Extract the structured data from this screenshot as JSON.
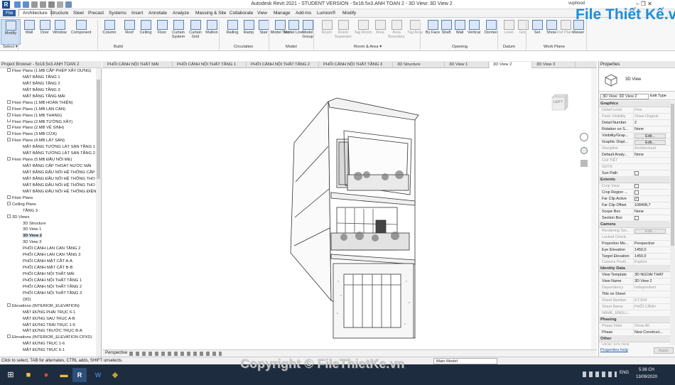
{
  "title_bar": {
    "title": "Autodesk Revit 2021 - STUDENT VERSION - 5x18.5x3.ANH TOAN 2 - 3D View: 3D View 2",
    "user": "vuphood",
    "window_controls": "–  ❐  ✕"
  },
  "menu": [
    "File",
    "Architecture",
    "Structure",
    "Steel",
    "Precast",
    "Systems",
    "Insert",
    "Annotate",
    "Analyze",
    "Massing & Site",
    "Collaborate",
    "View",
    "Manage",
    "Add-Ins",
    "Lumion®",
    "Modify"
  ],
  "ribbon": {
    "buttons": [
      {
        "label": "Modify",
        "disabled": false
      },
      {
        "label": "Wall",
        "disabled": false
      },
      {
        "label": "Door",
        "disabled": false
      },
      {
        "label": "Window",
        "disabled": false
      },
      {
        "label": "Component",
        "disabled": false
      },
      {
        "label": "Column",
        "disabled": false
      },
      {
        "label": "Roof",
        "disabled": false
      },
      {
        "label": "Ceiling",
        "disabled": false
      },
      {
        "label": "Floor",
        "disabled": false
      },
      {
        "label": "Curtain System",
        "disabled": false
      },
      {
        "label": "Curtain Grid",
        "disabled": false
      },
      {
        "label": "Mullion",
        "disabled": false
      },
      {
        "label": "Railing",
        "disabled": false
      },
      {
        "label": "Ramp",
        "disabled": false
      },
      {
        "label": "Stair",
        "disabled": false
      },
      {
        "label": "Model Text",
        "disabled": false
      },
      {
        "label": "Model Line",
        "disabled": false
      },
      {
        "label": "Model Group",
        "disabled": false
      },
      {
        "label": "Room",
        "disabled": true
      },
      {
        "label": "Room Separator",
        "disabled": true
      },
      {
        "label": "Tag Room",
        "disabled": true
      },
      {
        "label": "Area",
        "disabled": true
      },
      {
        "label": "Area Boundary",
        "disabled": true
      },
      {
        "label": "Tag Area",
        "disabled": true
      },
      {
        "label": "By Face",
        "disabled": false
      },
      {
        "label": "Shaft",
        "disabled": false
      },
      {
        "label": "Wall",
        "disabled": false
      },
      {
        "label": "Vertical",
        "disabled": false
      },
      {
        "label": "Dormer",
        "disabled": false
      },
      {
        "label": "Level",
        "disabled": true
      },
      {
        "label": "Grid",
        "disabled": true
      },
      {
        "label": "Set",
        "disabled": false
      },
      {
        "label": "Show",
        "disabled": false
      },
      {
        "label": "Ref Plane",
        "disabled": true
      },
      {
        "label": "Viewer",
        "disabled": false
      }
    ],
    "groups": [
      "Select ▾",
      "Build",
      "Circulation",
      "Model",
      "Room & Area ▾",
      "Opening",
      "Datum",
      "Work Plane"
    ]
  },
  "view_tabs": [
    "PHỐI CẢNH NỘI THẤT MÁI",
    "PHỐI CẢNH NỘI THẤT TẦNG 1",
    "PHỐI CẢNH NỘI THẤT TẦNG 2",
    "PHỐI CẢNH NỘI THẤT TẦNG 3",
    "3D Structure",
    "3D View 1",
    "3D View 2",
    "3D View 3"
  ],
  "active_view_tab": "3D View 2",
  "project_browser": {
    "title": "Project Browser - 5x18.5x3.ANH TOAN 2",
    "items": [
      {
        "text": "Floor Plans (1.MB CẤP PHÉP XÂY DỰNG)",
        "level": 1,
        "toggle": true
      },
      {
        "text": "MẶT BẰNG TẦNG 1",
        "level": 2
      },
      {
        "text": "MẶT BẰNG TẦNG 2",
        "level": 2
      },
      {
        "text": "MẶT BẰNG TẦNG 3",
        "level": 2
      },
      {
        "text": "MẶT BẰNG TẦNG MÁI",
        "level": 2
      },
      {
        "text": "Floor Plans (1.MB HOÀN THIỆN)",
        "level": 1,
        "toggle": true
      },
      {
        "text": "Floor Plans (1.MB LAN CAN)",
        "level": 1,
        "toggle": true
      },
      {
        "text": "Floor Plans (1.MB THANG)",
        "level": 1,
        "toggle": true
      },
      {
        "text": "Floor Plans (2.MB TƯỜNG XÂY)",
        "level": 1,
        "toggle": true
      },
      {
        "text": "Floor Plans (2.MB VỆ SINH)",
        "level": 1,
        "toggle": true
      },
      {
        "text": "Floor Plans (3.MB CỬA)",
        "level": 1,
        "toggle": true
      },
      {
        "text": "Floor Plans (4.MB LÁT SÀN)",
        "level": 1,
        "toggle": true
      },
      {
        "text": "MẶT BẰNG TƯỜNG LÁT SÀN TẦNG 1",
        "level": 2
      },
      {
        "text": "MẶT BẰNG TƯỜNG LÁT SÀN TẦNG 2",
        "level": 2
      },
      {
        "text": "Floor Plans (5.MB ĐẦU NỐI ME)",
        "level": 1,
        "toggle": true
      },
      {
        "text": "MẶT BẰNG CẤP THOÁT NƯỚC MÁI",
        "level": 2
      },
      {
        "text": "MẶT BẰNG ĐẦU NỐI HỆ THỐNG CẤP",
        "level": 2
      },
      {
        "text": "MẶT BẰNG ĐẦU NỐI HỆ THỐNG THO",
        "level": 2
      },
      {
        "text": "MẶT BẰNG ĐẦU NỐI HỆ THỐNG THO",
        "level": 2
      },
      {
        "text": "MẶT BẰNG ĐẦU NỐI HỆ THỐNG ĐIỆN",
        "level": 2
      },
      {
        "text": "Floor Plans",
        "level": 1,
        "toggle": true
      },
      {
        "text": "Ceiling Plans",
        "level": 1,
        "toggle": true
      },
      {
        "text": "TẦNG 3",
        "level": 2
      },
      {
        "text": "3D Views",
        "level": 1,
        "toggle": true
      },
      {
        "text": "3D Structure",
        "level": 2
      },
      {
        "text": "3D View 1",
        "level": 2
      },
      {
        "text": "3D View 2",
        "level": 2,
        "selected": true
      },
      {
        "text": "3D View 3",
        "level": 2
      },
      {
        "text": "PHỐI CẢNH LAN CAN TẦNG 2",
        "level": 2
      },
      {
        "text": "PHỐI CẢNH LAN CAN TẦNG 3",
        "level": 2
      },
      {
        "text": "PHỐI CẢNH MẶT CẮT A-A",
        "level": 2
      },
      {
        "text": "PHỐI CẢNH MẶT CẮT B-B",
        "level": 2
      },
      {
        "text": "PHỐI CẢNH NỘI THẤT MÁI",
        "level": 2
      },
      {
        "text": "PHỐI CẢNH NỘI THẤT TẦNG 1",
        "level": 2
      },
      {
        "text": "PHỐI CẢNH NỘI THẤT TẦNG 2",
        "level": 2
      },
      {
        "text": "PHỐI CẢNH NỘI THẤT TẦNG 3",
        "level": 2
      },
      {
        "text": "{3D}",
        "level": 2
      },
      {
        "text": "Elevations (INTERIOR_ELEVATION)",
        "level": 1,
        "toggle": true
      },
      {
        "text": "MẶT ĐỨNG PHẢI TRỤC 6-1",
        "level": 2
      },
      {
        "text": "MẶT ĐỨNG SAU TRỤC A-B",
        "level": 2
      },
      {
        "text": "MẶT ĐỨNG TRÁI TRỤC 1-6",
        "level": 2
      },
      {
        "text": "MẶT ĐỨNG TRƯỚC TRỤC B-A",
        "level": 2
      },
      {
        "text": "Elevations (INTERIOR_ELEVATION CPXD)",
        "level": 1,
        "toggle": true
      },
      {
        "text": "MẶT ĐỨNG TRỤC 1-6",
        "level": 2
      },
      {
        "text": "MẶT ĐỨNG TRỤC 6-1",
        "level": 2
      }
    ]
  },
  "view_cube_label": "LEFT",
  "view_control_bar": {
    "label": "Perspective"
  },
  "properties": {
    "title": "Properties",
    "type_name": "3D View",
    "selector": "3D View: 3D View 2",
    "edit_type": "Edit Type",
    "sections": [
      {
        "name": "Graphics",
        "rows": [
          {
            "k": "Detail Level",
            "v": "Fine",
            "dim": true
          },
          {
            "k": "Parts Visibility",
            "v": "Show Original",
            "dim": true
          },
          {
            "k": "Detail Number",
            "v": "2"
          },
          {
            "k": "Rotation on S...",
            "v": "None"
          },
          {
            "k": "Visibility/Grap...",
            "v": "Edit...",
            "button": true
          },
          {
            "k": "Graphic Displ...",
            "v": "Edit...",
            "button": true
          },
          {
            "k": "Discipline",
            "v": "Architectural",
            "dim": true
          },
          {
            "k": "Default Analy...",
            "v": "None"
          },
          {
            "k": "CHI TIẾT",
            "v": "",
            "dim": true
          },
          {
            "k": "GDTK",
            "v": "",
            "dim": true
          },
          {
            "k": "Sun Path",
            "v": "",
            "check": false
          }
        ]
      },
      {
        "name": "Extents",
        "rows": [
          {
            "k": "Crop View",
            "v": "",
            "check": false,
            "dim": true
          },
          {
            "k": "Crop Region ...",
            "v": "",
            "check": false
          },
          {
            "k": "Far Clip Active",
            "v": "",
            "check": true
          },
          {
            "k": "Far Clip Offset",
            "v": "108408,7"
          },
          {
            "k": "Scope Box",
            "v": "None"
          },
          {
            "k": "Section Box",
            "v": "",
            "check": false
          }
        ]
      },
      {
        "name": "Camera",
        "rows": [
          {
            "k": "Rendering Set...",
            "v": "Edit...",
            "button": true,
            "dim": true
          },
          {
            "k": "Locked Orient...",
            "v": "",
            "dim": true
          },
          {
            "k": "Projection Mo...",
            "v": "Perspective"
          },
          {
            "k": "Eye Elevation",
            "v": "1450,0"
          },
          {
            "k": "Target Elevation",
            "v": "1450,0"
          },
          {
            "k": "Camera Positi...",
            "v": "Explicit",
            "dim": true
          }
        ]
      },
      {
        "name": "Identity Data",
        "rows": [
          {
            "k": "View Template",
            "v": "3D NGOAI THAT"
          },
          {
            "k": "View Name",
            "v": "3D View 2"
          },
          {
            "k": "Dependency",
            "v": "Independent",
            "dim": true
          },
          {
            "k": "Title on Sheet",
            "v": ""
          },
          {
            "k": "Sheet Number",
            "v": "KT-504",
            "dim": true
          },
          {
            "k": "Sheet Name",
            "v": "PHỐI CẢNH",
            "dim": true
          },
          {
            "k": "NAME_ENGLI...",
            "v": "",
            "dim": true
          }
        ]
      },
      {
        "name": "Phasing",
        "rows": [
          {
            "k": "Phase Filter",
            "v": "Show All",
            "dim": true
          },
          {
            "k": "Phase",
            "v": "New Construct..."
          }
        ]
      },
      {
        "name": "Other",
        "rows": [
          {
            "k": "VIEW_FOLDER",
            "v": "",
            "dim": true
          }
        ]
      }
    ],
    "help": "Properties help",
    "apply": "Apply"
  },
  "status_bar": {
    "text": "Click to select, TAB for alternates, CTRL adds, SHIFT unselects.",
    "model": "Main Model"
  },
  "taskbar": {
    "lang": "ENG",
    "time": "5:36 CH",
    "date": "13/09/2020"
  },
  "watermark": {
    "logo": "File Thiết Kế.vn",
    "copyright": "Copyright © FileThietKe.vn"
  },
  "colors": {
    "ribbon_icon": "#5a7fb0",
    "taskbar": "#1d2c3e",
    "watermark_blue": "#1e8ed8",
    "selection": "#dde6f5"
  }
}
